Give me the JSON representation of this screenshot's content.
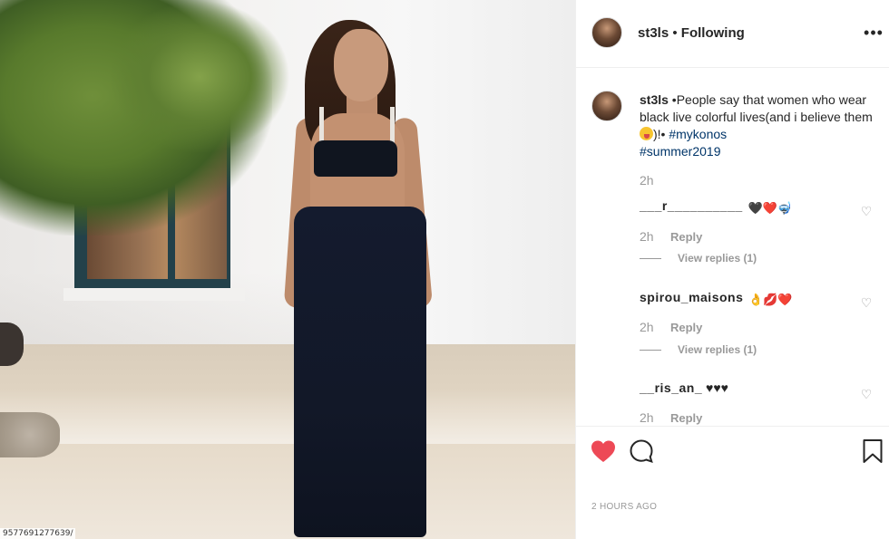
{
  "photo": {
    "watermark": "9577691277639/"
  },
  "header": {
    "username": "st3ls",
    "separator": " • ",
    "follow_status": "Following",
    "more_label": "•••"
  },
  "caption": {
    "username": "st3ls",
    "text_before_emoji": " •People say that women who wear black live colorful lives(and i believe them ",
    "text_after_emoji": ")!• ",
    "hashtag1": "#mykonos",
    "hashtag2": "#summer2019",
    "time": "2h"
  },
  "comments": [
    {
      "username": "___r__________",
      "emojis": [
        "🖤",
        "❤️",
        "🤿"
      ],
      "time": "2h",
      "reply_label": "Reply",
      "view_replies": "View replies (1)"
    },
    {
      "username": "spirou_maisons",
      "emojis": [
        "👌",
        "💋",
        "❤️"
      ],
      "time": "2h",
      "reply_label": "Reply",
      "view_replies": "View replies (1)"
    },
    {
      "username": "__ris_an_",
      "emojis": [
        "♥♥♥"
      ],
      "time": "2h",
      "reply_label": "Reply"
    }
  ],
  "actions": {
    "like_color": "#ed4956",
    "posted_time": "2 HOURS AGO"
  },
  "icons": {
    "like": "heart-icon",
    "comment": "comment-icon",
    "save": "bookmark-icon",
    "comment_like": "heart-outline-icon"
  }
}
